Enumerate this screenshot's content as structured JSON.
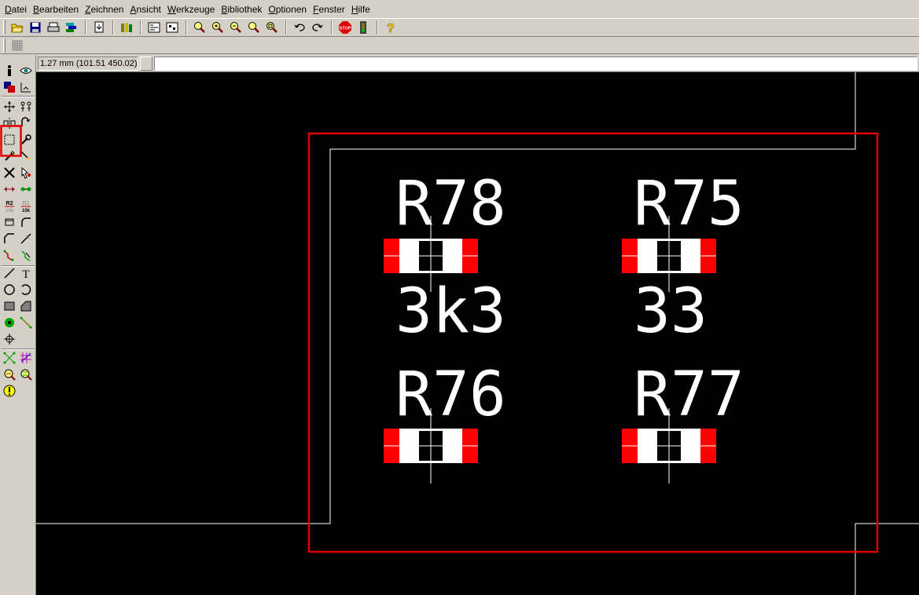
{
  "menu": [
    {
      "label": "Datei",
      "u": "D"
    },
    {
      "label": "Bearbeiten",
      "u": "B"
    },
    {
      "label": "Zeichnen",
      "u": "Z"
    },
    {
      "label": "Ansicht",
      "u": "A"
    },
    {
      "label": "Werkzeuge",
      "u": "W"
    },
    {
      "label": "Bibliothek",
      "u": "B"
    },
    {
      "label": "Optionen",
      "u": "O"
    },
    {
      "label": "Fenster",
      "u": "F"
    },
    {
      "label": "Hilfe",
      "u": "H"
    }
  ],
  "coord_readout": "1.27 mm (101.51 450.02)",
  "command_line_value": "",
  "board": {
    "components": [
      {
        "name": "R78",
        "value": "3k3"
      },
      {
        "name": "R75",
        "value": "33"
      },
      {
        "name": "R76",
        "value": ""
      },
      {
        "name": "R77",
        "value": ""
      }
    ]
  },
  "colors": {
    "canvas_bg": "#000000",
    "outline": "#ffffff",
    "pad": "#ff0000",
    "highlight": "#e00000",
    "text": "#ffffff"
  }
}
